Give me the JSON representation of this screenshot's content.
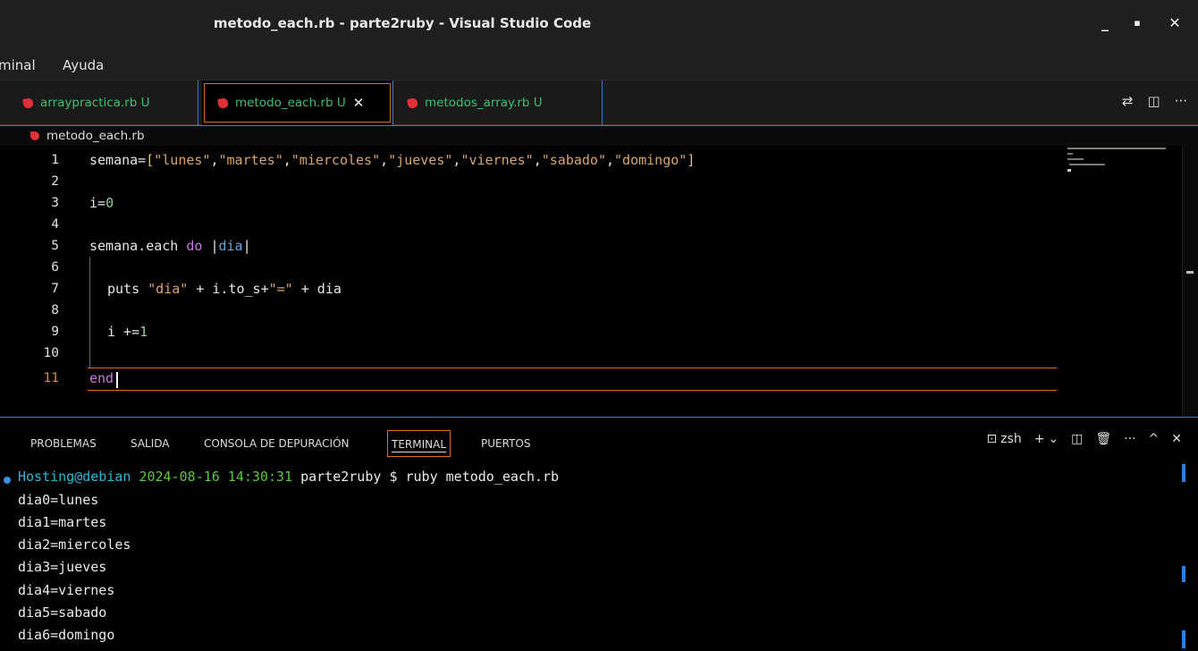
{
  "window": {
    "title": "metodo_each.rb - parte2ruby - Visual Studio Code",
    "minimize": "_",
    "maximize": "▪",
    "close": "✕"
  },
  "menu": {
    "items": [
      "minal",
      "Ayuda"
    ]
  },
  "tabs": [
    {
      "label": "arraypractica.rb U",
      "icon": "ruby-icon"
    },
    {
      "label": "metodo_each.rb U",
      "icon": "ruby-icon",
      "close": "✕"
    },
    {
      "label": "metodos_array.rb U",
      "icon": "ruby-icon"
    }
  ],
  "tab_actions": {
    "compare_icon": "⇄",
    "split_icon": "◫",
    "more_icon": "···"
  },
  "breadcrumb": {
    "file": "metodo_each.rb"
  },
  "editor": {
    "line_numbers": [
      "1",
      "2",
      "3",
      "4",
      "5",
      "6",
      "7",
      "8",
      "9",
      "10",
      "11"
    ],
    "current_line": "11",
    "code": {
      "l1_var": "semana=",
      "l1_open": "[",
      "l1_items": [
        "\"lunes\"",
        "\"martes\"",
        "\"miercoles\"",
        "\"jueves\"",
        "\"viernes\"",
        "\"sabado\"",
        "\"domingo\""
      ],
      "l1_close": "]",
      "l3_var": "i=",
      "l3_num": "0",
      "l5_recv": "semana.each ",
      "l5_kw": "do",
      "l5_pipe1": " |",
      "l5_param": "dia",
      "l5_pipe2": "|",
      "l7_fn": "puts ",
      "l7_str1": "\"dia\"",
      "l7_mid": " + i.to_s+",
      "l7_str2": "\"=\"",
      "l7_end": " + dia",
      "l9_var": "i +=",
      "l9_num": "1",
      "l11_kw": "end"
    }
  },
  "panel": {
    "tabs": [
      "PROBLEMAS",
      "SALIDA",
      "CONSOLA DE DEPURACIÓN",
      "TERMINAL",
      "PUERTOS"
    ],
    "active_tab": "TERMINAL",
    "shell": "zsh",
    "actions": {
      "terminal_icon": "⊡",
      "add": "+",
      "dropdown": "⌄",
      "split": "◫",
      "trash": "🗑",
      "more": "···",
      "maximize": "^",
      "close": "✕"
    }
  },
  "terminal": {
    "prompt_user": "Hosting@debian",
    "prompt_date": "2024-08-16 14:30:31",
    "prompt_cwd": "parte2ruby",
    "prompt_symbol": "$",
    "command": "ruby metodo_each.rb",
    "output": [
      "dia0=lunes",
      "dia1=martes",
      "dia2=miercoles",
      "dia3=jueves",
      "dia4=viernes",
      "dia5=sabado",
      "dia6=domingo"
    ]
  },
  "colors": {
    "accent_orange": "#d86e1c",
    "tab_border_blue": "#3a7ac0",
    "git_untracked_green": "#3fbf6f",
    "ruby_red": "#e0303a"
  }
}
